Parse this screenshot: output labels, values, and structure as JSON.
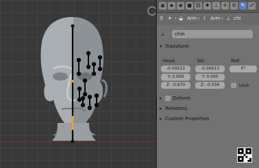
{
  "toolbar": {
    "tabs": [
      {
        "icon": "render-icon"
      },
      {
        "icon": "scene-icon"
      },
      {
        "icon": "world-icon"
      },
      {
        "icon": "object-icon"
      },
      {
        "icon": "constraint-icon"
      },
      {
        "icon": "modifier-icon"
      },
      {
        "icon": "bone-icon",
        "active": true
      },
      {
        "icon": "bone-constraint-icon"
      }
    ]
  },
  "breadcrumb": {
    "items": [
      "Arm",
      "Arm",
      "chi"
    ]
  },
  "bone_name": "chin",
  "transform": {
    "title": "Transform",
    "head_label": "Head:",
    "tail_label": "Tail:",
    "roll_label": "Roll:",
    "head": [
      "-0.00013",
      "Y: 0.000",
      "Z: -0.670"
    ],
    "tail": [
      "-0.00013",
      "Y: 0.000",
      "Z: -0.556"
    ],
    "roll": "0°",
    "lock_label": "Lock"
  },
  "sections": {
    "deform": "Deform",
    "relations": "Relations",
    "custom_properties": "Custom Properties"
  },
  "colors": {
    "active_tab": "#5680c2",
    "selected_bone": "#f0a030",
    "axis_red": "#a03030"
  }
}
